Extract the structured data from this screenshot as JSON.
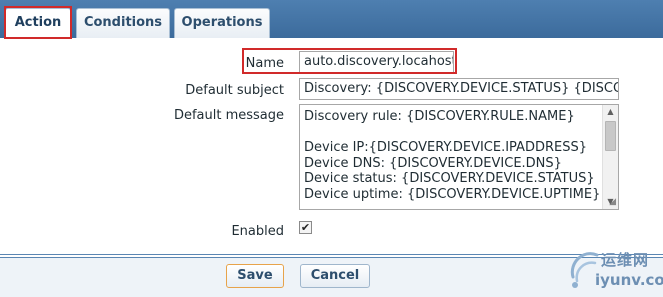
{
  "tabs": [
    {
      "label": "Action",
      "active": true
    },
    {
      "label": "Conditions",
      "active": false
    },
    {
      "label": "Operations",
      "active": false
    }
  ],
  "form": {
    "name_label": "Name",
    "name_value": "auto.discovery.locahost",
    "subject_label": "Default subject",
    "subject_value": "Discovery: {DISCOVERY.DEVICE.STATUS} {DISCO",
    "message_label": "Default message",
    "message_value": "Discovery rule: {DISCOVERY.RULE.NAME}\n\nDevice IP:{DISCOVERY.DEVICE.IPADDRESS}\nDevice DNS: {DISCOVERY.DEVICE.DNS}\nDevice status: {DISCOVERY.DEVICE.STATUS}\nDevice uptime: {DISCOVERY.DEVICE.UPTIME}",
    "enabled_label": "Enabled",
    "enabled": true
  },
  "buttons": {
    "save_label": "Save",
    "cancel_label": "Cancel"
  },
  "watermark": {
    "cn": "运维网",
    "en": "iyunv.com"
  },
  "colors": {
    "tab_bar": "#4e7fb0",
    "highlight": "#d12a2a",
    "save_border": "#e7a34a"
  }
}
